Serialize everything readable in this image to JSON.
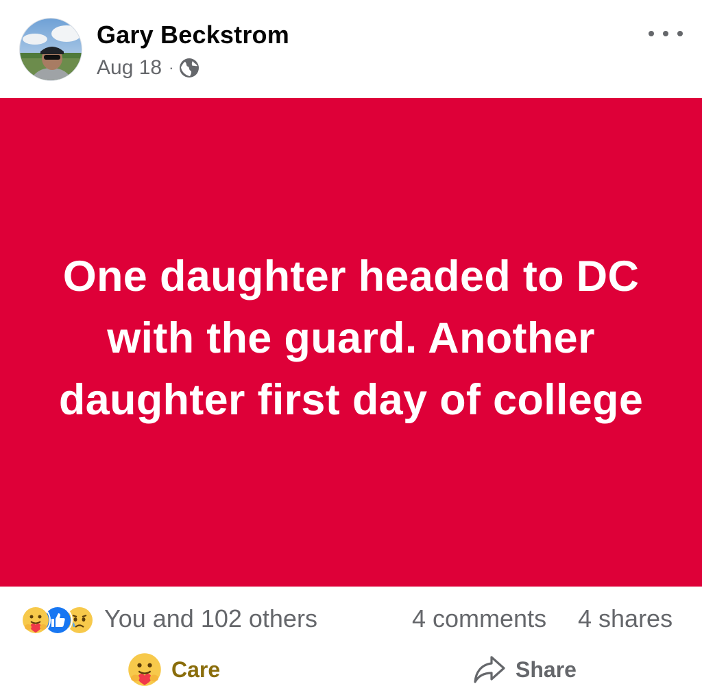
{
  "post": {
    "author": "Gary Beckstrom",
    "date": "Aug 18",
    "separator": "·",
    "privacy_icon": "globe-icon",
    "more_icon": "more-options-icon",
    "background_color": "#de0038",
    "text": "One daughter headed to DC with the guard. Another daughter first day of college"
  },
  "stats": {
    "reactions": [
      "care",
      "like",
      "sad"
    ],
    "reactions_text": "You and 102 others",
    "comments": "4 comments",
    "shares": "4 shares"
  },
  "actions": {
    "care_label": "Care",
    "care_color": "#8a6d0b",
    "share_label": "Share"
  }
}
